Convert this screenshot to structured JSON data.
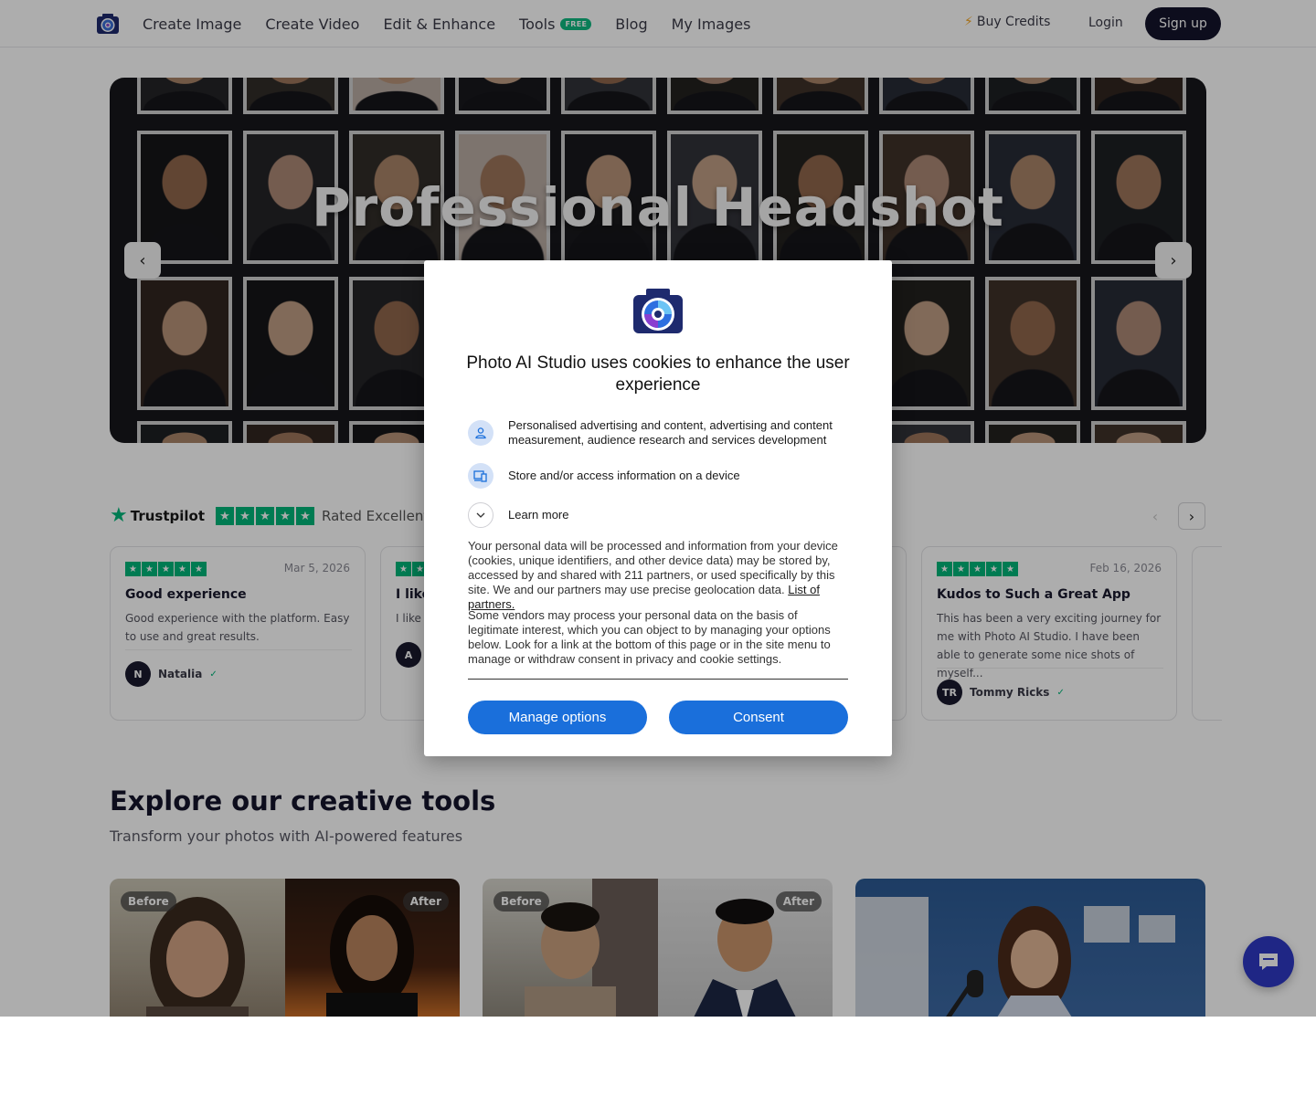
{
  "nav": {
    "links": [
      "Create Image",
      "Create Video",
      "Edit & Enhance",
      "Tools",
      "Blog",
      "My Images"
    ],
    "tools_badge": "FREE",
    "buy_credits": "Buy Credits",
    "login": "Login",
    "signup": "Sign up"
  },
  "hero": {
    "title": "Professional Headshot",
    "prev_icon": "chevron-left-icon",
    "next_icon": "chevron-right-icon"
  },
  "trustpilot": {
    "brand": "Trustpilot",
    "rated_text": "Rated Excellent on T",
    "stars": 5
  },
  "reviews": [
    {
      "stars": 5,
      "date": "Mar 5, 2026",
      "title": "Good experience",
      "body": "Good experience with the platform. Easy to use and great results.",
      "initials": "N",
      "name": "Natalia"
    },
    {
      "stars": 5,
      "date": "",
      "title": "I like",
      "body": "I like i",
      "initials": "A",
      "name": ""
    },
    {
      "stars": 5,
      "date": "Feb 16, 2026",
      "title": "Kudos to Such a Great App",
      "body": "This has been a very exciting journey for me with Photo AI Studio. I have been able to generate some nice shots of myself...",
      "initials": "TR",
      "name": "Tommy Ricks"
    }
  ],
  "explore": {
    "title": "Explore our creative tools",
    "subtitle": "Transform your photos with AI-powered features",
    "before_label": "Before",
    "after_label": "After"
  },
  "consent": {
    "title": "Photo AI Studio uses cookies to enhance the user experience",
    "purposes": [
      {
        "icon": "person-icon",
        "text": "Personalised advertising and content, advertising and content measurement, audience research and services development"
      },
      {
        "icon": "devices-icon",
        "text": "Store and/or access information on a device"
      }
    ],
    "learn_more": "Learn more",
    "para1": "Your personal data will be processed and information from your device (cookies, unique identifiers, and other device data) may be stored by, accessed by and shared with 211 partners, or used specifically by this site. We and our partners may use precise geolocation data.",
    "partners_link": "List of partners.",
    "para2": "Some vendors may process your personal data on the basis of legitimate interest, which you can object to by managing your options below. Look for a link at the bottom of this page or in the site menu to manage or withdraw consent in privacy and cookie settings.",
    "manage_button": "Manage options",
    "consent_button": "Consent"
  },
  "colors": {
    "brand_dark": "#14142b",
    "trustpilot_green": "#00b67a",
    "consent_blue": "#1a6fdb",
    "chat_blue": "#2f38c4"
  }
}
